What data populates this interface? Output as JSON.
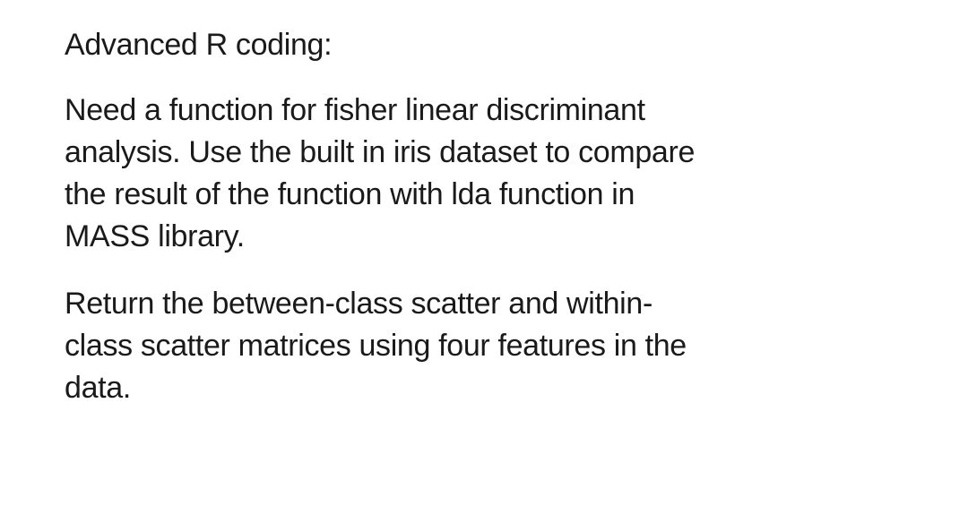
{
  "document": {
    "heading": "Advanced R coding:",
    "paragraph1": "Need a function for fisher linear discriminant analysis. Use the built in iris dataset to compare the result of the function with lda function in MASS library.",
    "paragraph2": "Return the between-class scatter and within-class scatter matrices using four features in the data."
  }
}
